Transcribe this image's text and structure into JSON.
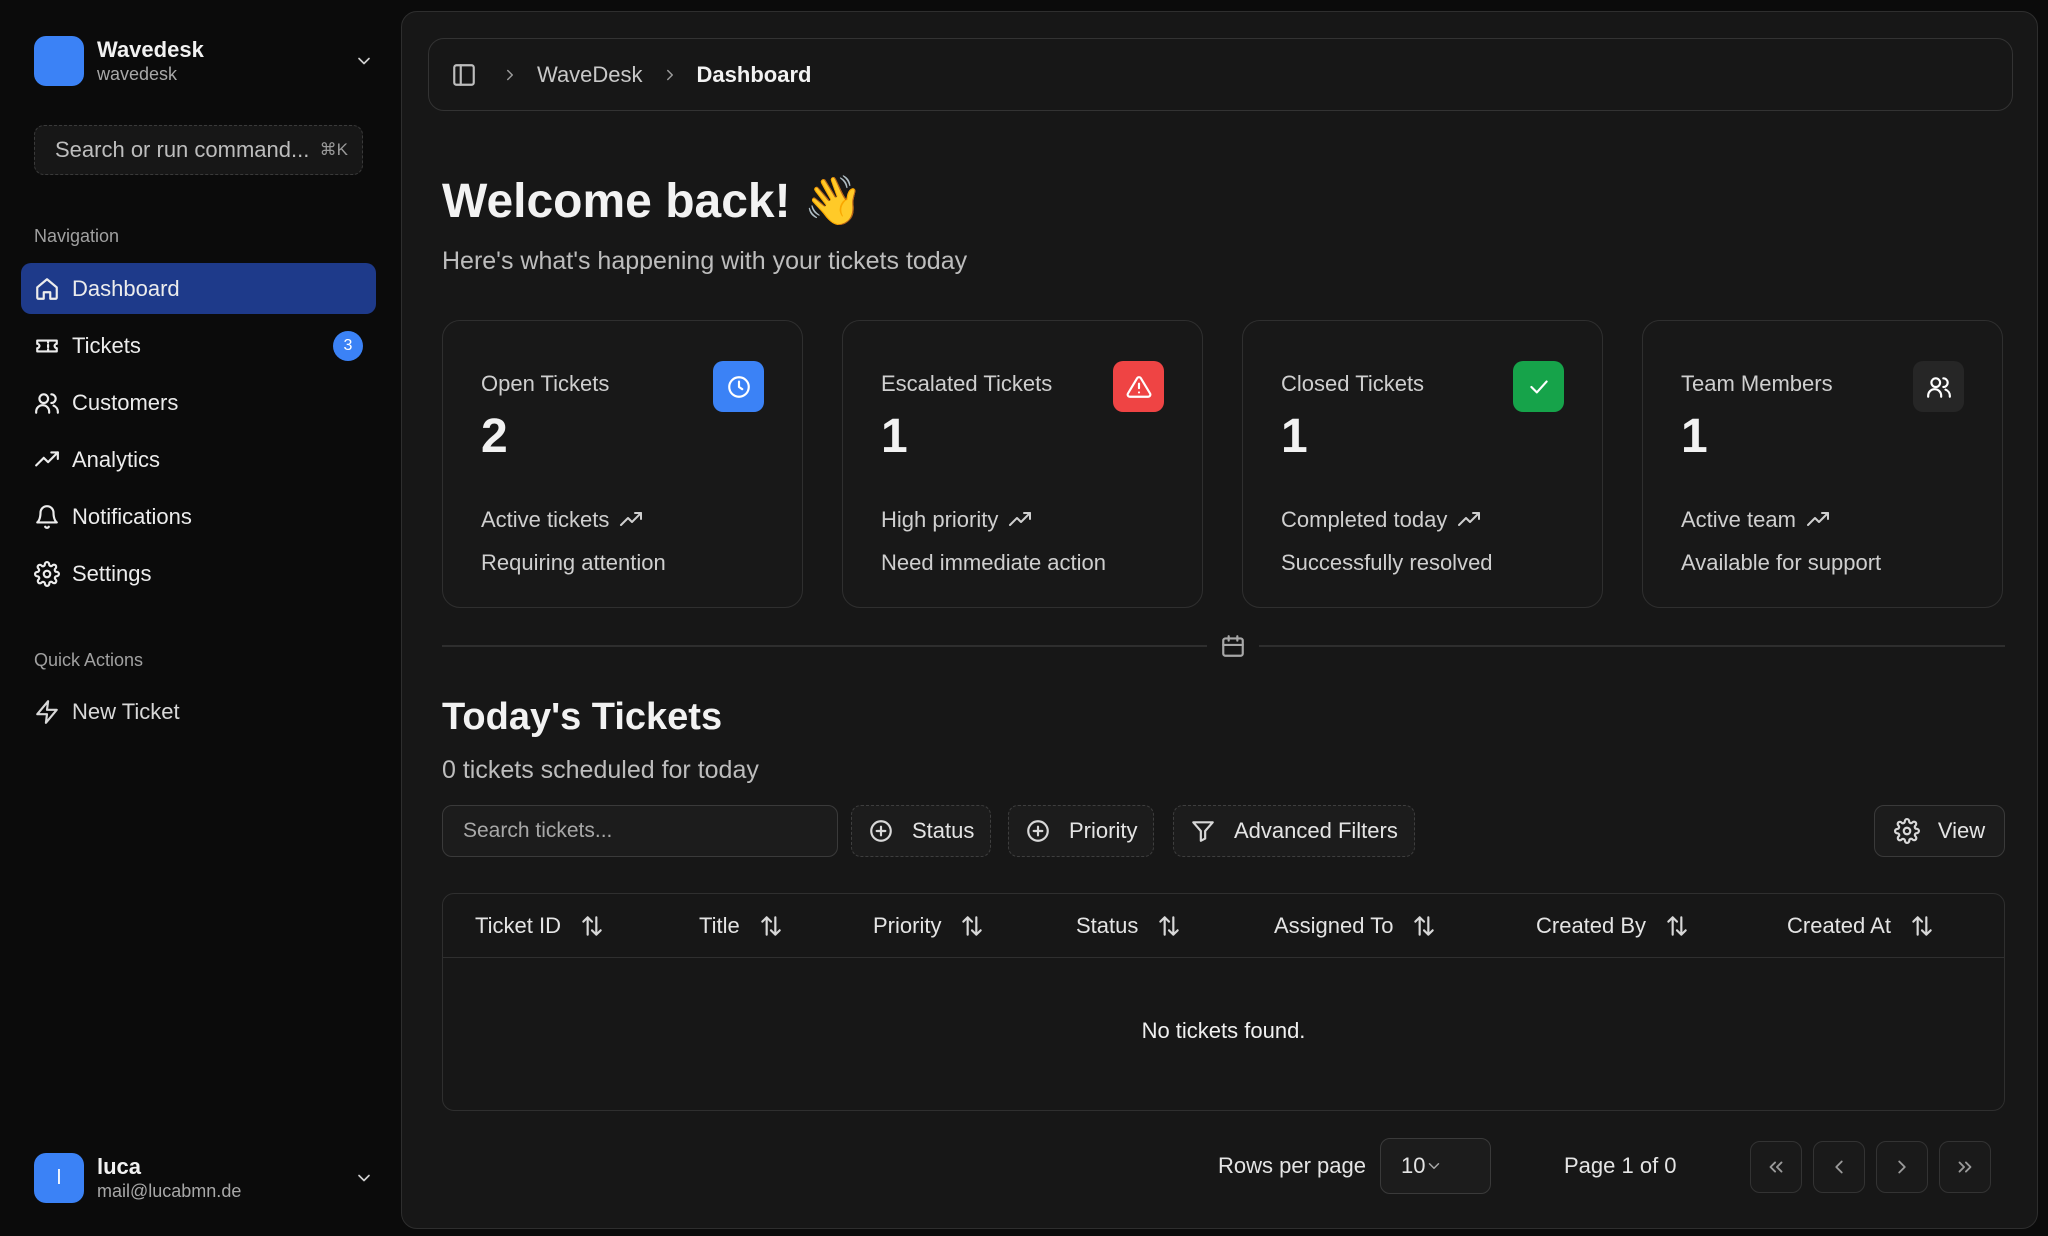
{
  "workspace": {
    "name": "Wavedesk",
    "slug": "wavedesk",
    "logo_color": "#3b82f6"
  },
  "command_search": {
    "placeholder": "Search or run command...",
    "shortcut": "⌘K"
  },
  "navigation": {
    "label": "Navigation",
    "items": [
      {
        "label": "Dashboard",
        "icon": "home-icon",
        "active": true
      },
      {
        "label": "Tickets",
        "icon": "ticket-icon",
        "badge": "3"
      },
      {
        "label": "Customers",
        "icon": "users-icon"
      },
      {
        "label": "Analytics",
        "icon": "trending-up-icon"
      },
      {
        "label": "Notifications",
        "icon": "bell-icon"
      },
      {
        "label": "Settings",
        "icon": "gear-icon"
      }
    ]
  },
  "quick_actions": {
    "label": "Quick Actions",
    "items": [
      {
        "label": "New Ticket",
        "icon": "zap-icon"
      }
    ]
  },
  "user": {
    "initial": "l",
    "name": "luca",
    "email": "mail@lucabmn.de"
  },
  "breadcrumb": {
    "items": [
      "WaveDesk",
      "Dashboard"
    ]
  },
  "welcome": {
    "title": "Welcome back! 👋",
    "subtitle": "Here's what's happening with your tickets today"
  },
  "stats": [
    {
      "title": "Open Tickets",
      "value": "2",
      "line1": "Active tickets",
      "line2": "Requiring attention",
      "icon": "clock-icon",
      "color": "#3b82f6"
    },
    {
      "title": "Escalated Tickets",
      "value": "1",
      "line1": "High priority",
      "line2": "Need immediate action",
      "icon": "alert-triangle-icon",
      "color": "#ef4444"
    },
    {
      "title": "Closed Tickets",
      "value": "1",
      "line1": "Completed today",
      "line2": "Successfully resolved",
      "icon": "check-icon",
      "color": "#16a34a"
    },
    {
      "title": "Team Members",
      "value": "1",
      "line1": "Active team",
      "line2": "Available for support",
      "icon": "users-icon",
      "color": "#262626"
    }
  ],
  "today": {
    "title": "Today's Tickets",
    "subtitle": "0 tickets scheduled for today"
  },
  "filters": {
    "search_placeholder": "Search tickets...",
    "status_label": "Status",
    "priority_label": "Priority",
    "advanced_label": "Advanced Filters",
    "view_label": "View"
  },
  "table": {
    "columns": [
      "Ticket ID",
      "Title",
      "Priority",
      "Status",
      "Assigned To",
      "Created By",
      "Created At"
    ],
    "empty_message": "No tickets found."
  },
  "pagination": {
    "rows_label": "Rows per page",
    "rows_value": "10",
    "page_info": "Page 1 of 0"
  }
}
